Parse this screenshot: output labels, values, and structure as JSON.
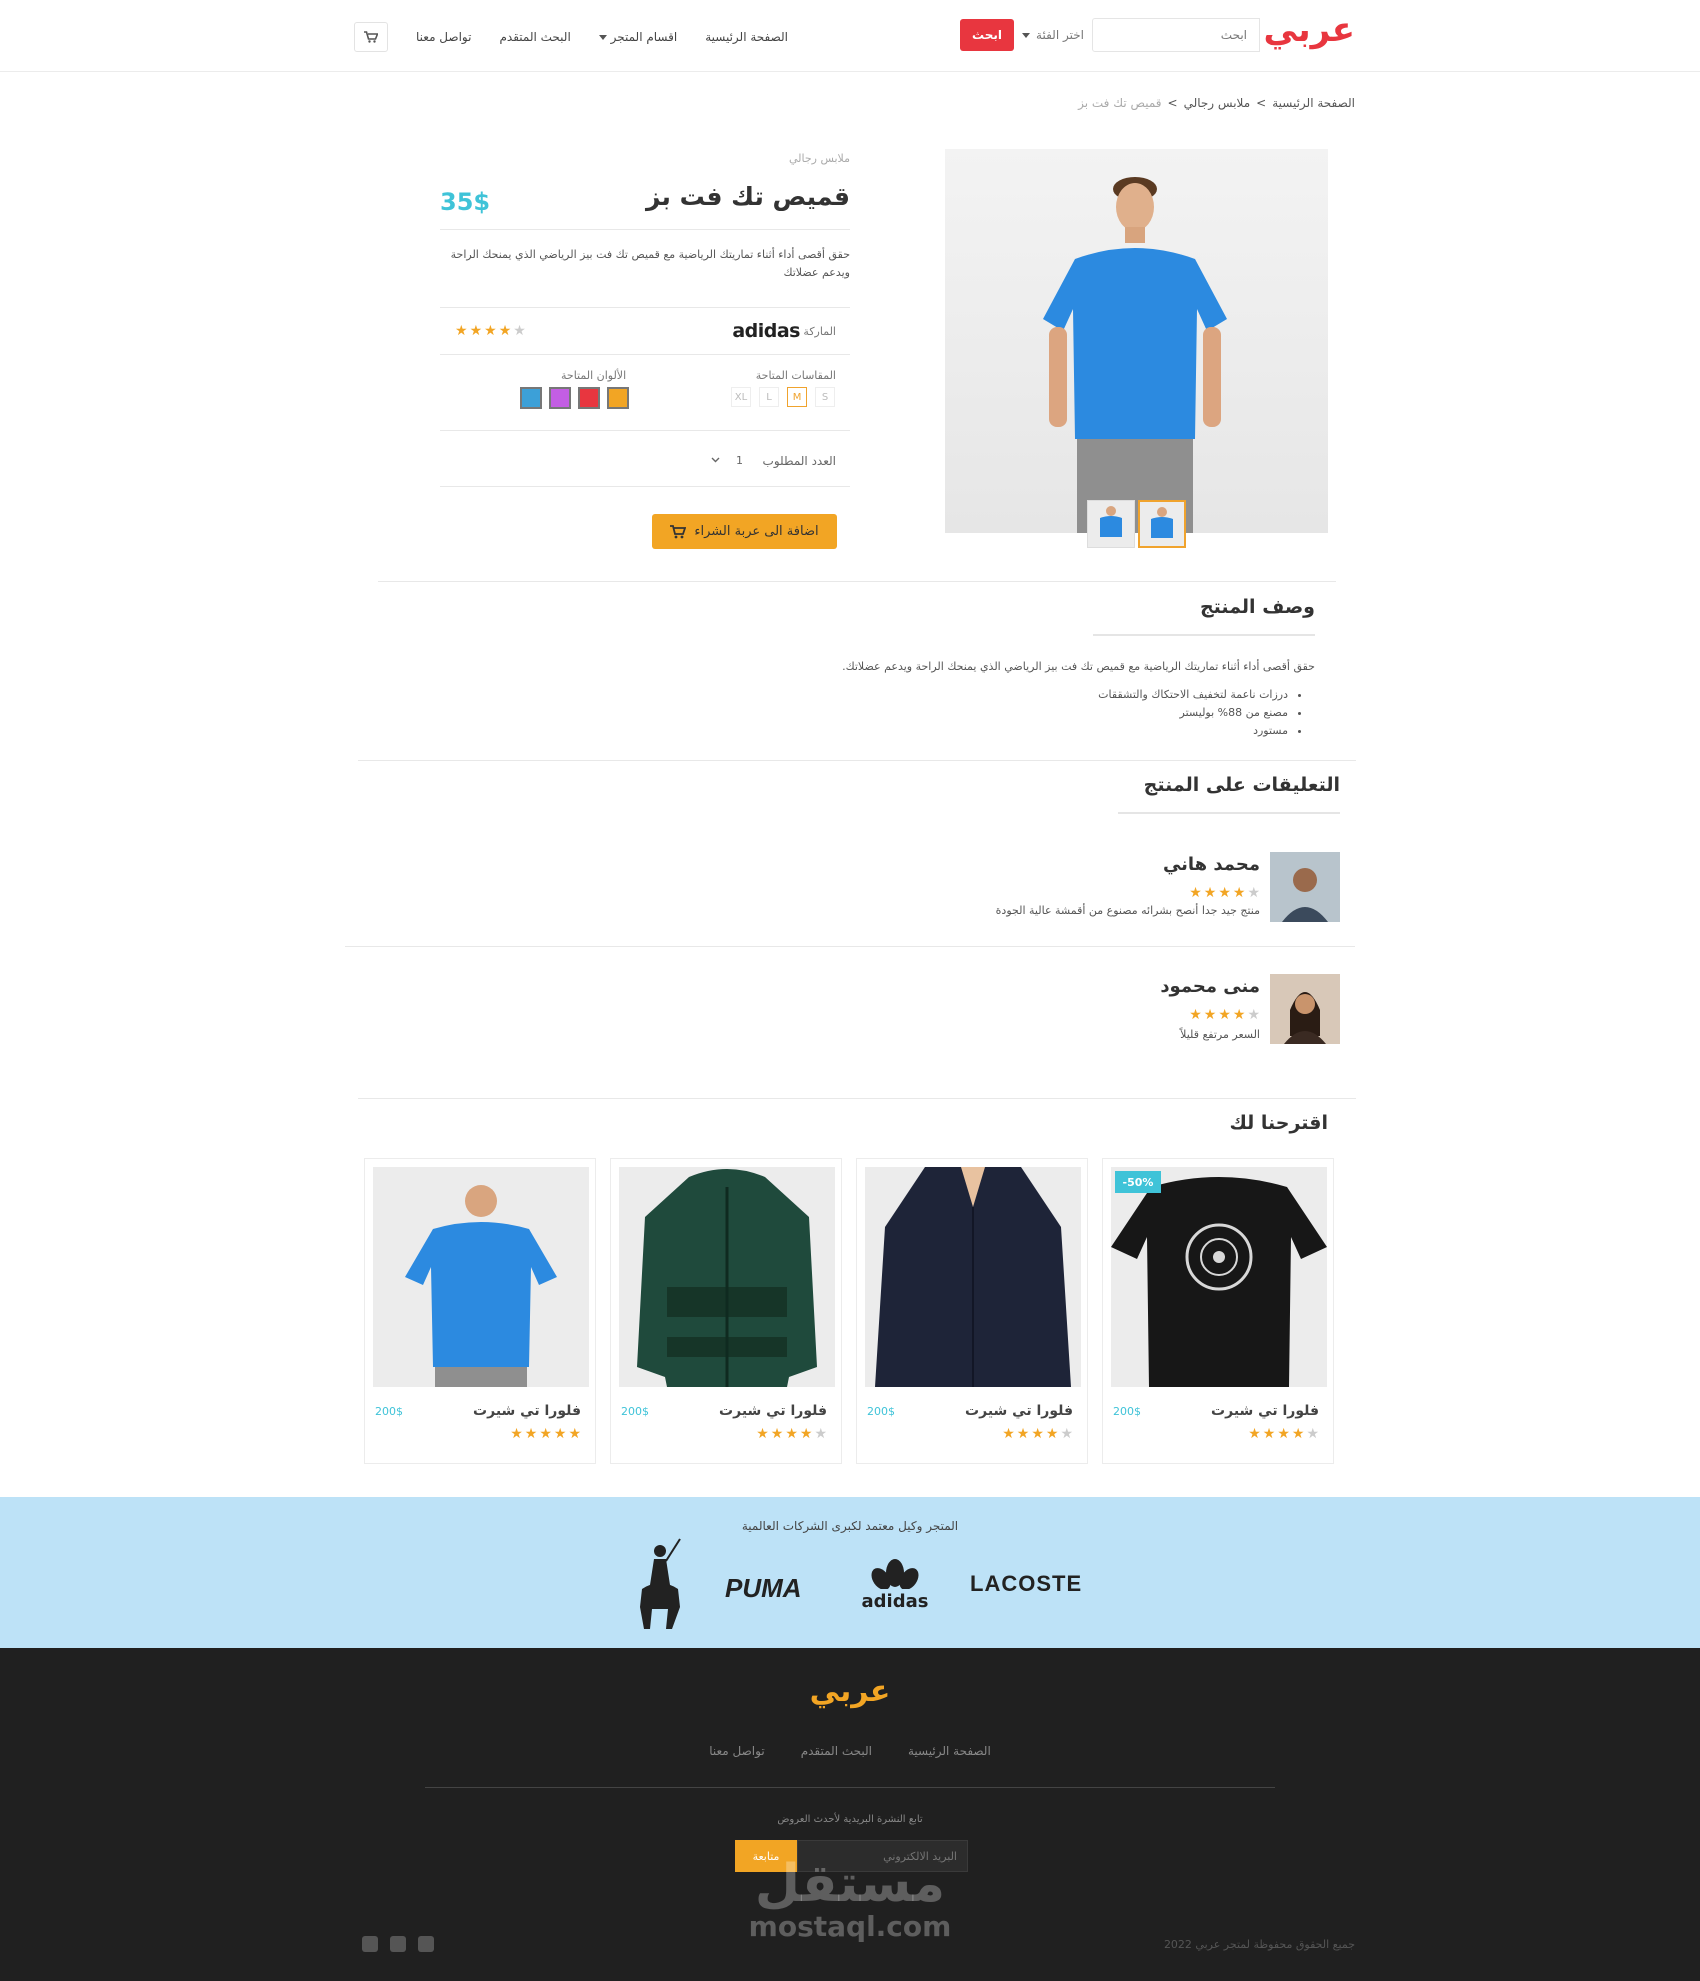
{
  "header": {
    "logo": "عربي",
    "search_placeholder": "ابحث",
    "category_select": "اختر الفئة",
    "search_button": "ابحث",
    "nav": [
      "الصفحة الرئيسية",
      "اقسام المتجر",
      "البحث المتقدم",
      "تواصل معنا"
    ]
  },
  "breadcrumb": [
    "الصفحة الرئيسية",
    "ملابس رجالي",
    "قميص تك فت بز"
  ],
  "product": {
    "category": "ملابس رجالي",
    "title": "قميص تك فت بز",
    "price": "35$",
    "description": "حقق أقصى أداء أثناء تماريتك الرياضية مع قميص تك فت بيز الرياضي الذي يمنحك الراحة ويدعم عضلاتك",
    "brand_label": "الماركة",
    "brand": "adidas",
    "rating": 4,
    "sizes_label": "المقاسات المتاحة",
    "sizes": [
      "S",
      "M",
      "L",
      "XL"
    ],
    "selected_size": "M",
    "colors_label": "الألوان المتاحة",
    "colors": [
      "#f2a524",
      "#e8363f",
      "#c35ee3",
      "#3ca0d8"
    ],
    "quantity_label": "العدد المطلوب",
    "quantity": "1",
    "add_to_cart": "اضافة الى عربة الشراء"
  },
  "description_section": {
    "title": "وصف المنتج",
    "text": "حقق أقصى أداء أثناء تماريتك الرياضية مع قميص تك فت بيز الرياضي الذي يمنحك الراحة ويدعم عضلاتك.",
    "bullets": [
      "درزات ناعمة لتخفيف الاحتكاك والتشققات",
      "مصنع من 88% بوليستر",
      "مستورد"
    ]
  },
  "reviews_section": {
    "title": "التعليقات على المنتج",
    "reviews": [
      {
        "name": "محمد هاني",
        "rating": 4,
        "text": "منتج جيد جدا أنصح بشرائه مصنوع من أقمشة عالية الجودة"
      },
      {
        "name": "منى محمود",
        "rating": 4,
        "text": "السعر مرتفع قليلاً"
      }
    ]
  },
  "suggestions": {
    "title": "اقترحنا لك",
    "items": [
      {
        "title": "فلورا تي شيرت",
        "price": "200$",
        "rating": 4,
        "discount": "-50%",
        "image": "black-tshirt"
      },
      {
        "title": "فلورا تي شيرت",
        "price": "200$",
        "rating": 4,
        "discount": "",
        "image": "navy-blouse"
      },
      {
        "title": "فلورا تي شيرت",
        "price": "200$",
        "rating": 4,
        "discount": "",
        "image": "green-jacket"
      },
      {
        "title": "فلورا تي شيرت",
        "price": "200$",
        "rating": 5,
        "discount": "",
        "image": "blue-tshirt"
      }
    ]
  },
  "brands": {
    "title": "المتجر وكيل معتمد لكبرى الشركات العالمية",
    "logos": [
      "LACOSTE",
      "adidas",
      "PUMA",
      "polo-logo"
    ]
  },
  "footer": {
    "logo": "عربي",
    "nav": [
      "الصفحة الرئيسية",
      "البحث المتقدم",
      "تواصل معنا"
    ],
    "newsletter_label": "تابع النشرة البريدية لأحدث العروض",
    "newsletter_placeholder": "البريد الالكتروني",
    "newsletter_button": "متابعة",
    "copyright": "جميع الحقوق محفوظة لمتجر عربي 2022",
    "socials": [
      "facebook-icon",
      "twitter-icon",
      "instagram-icon"
    ]
  },
  "watermark": {
    "arabic": "مستقل",
    "latin": "mostaql.com"
  },
  "colors": {
    "accent": "#e8363f",
    "orange": "#f2a524",
    "teal": "#3fc3d8",
    "band": "#bde2f7",
    "footer": "#202020"
  }
}
